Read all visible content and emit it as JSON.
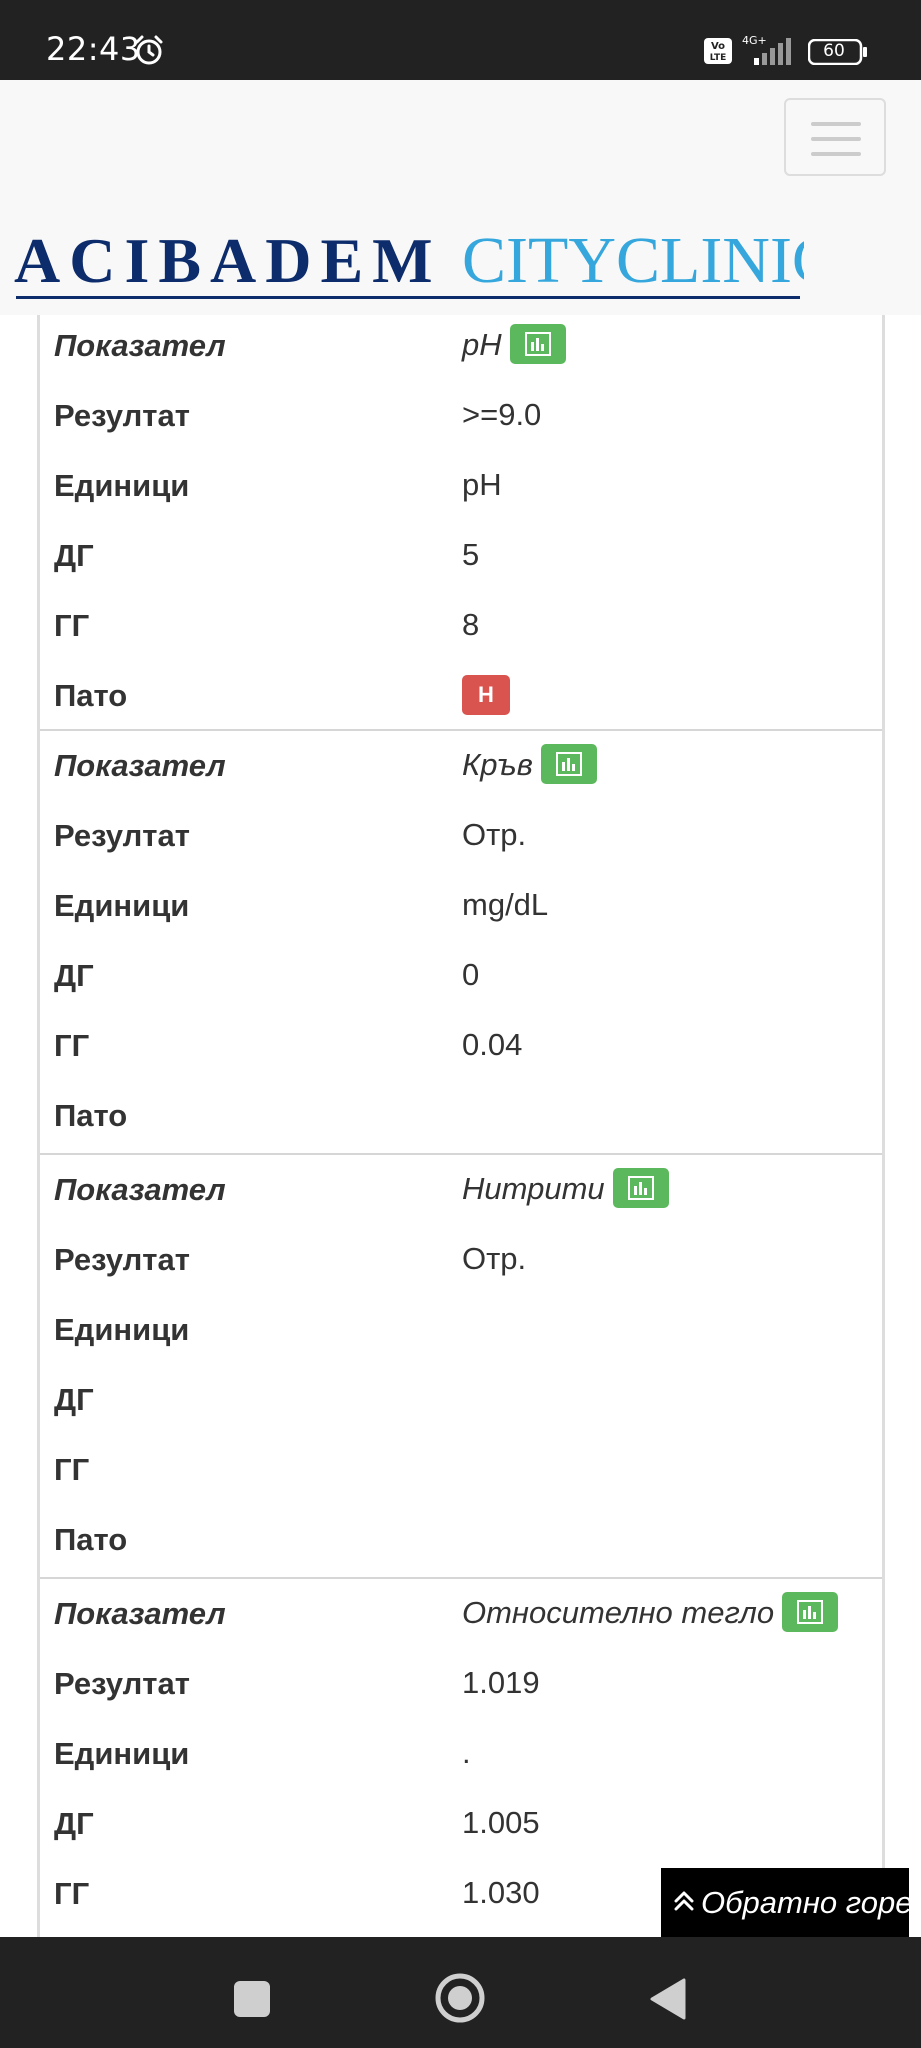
{
  "status_bar": {
    "time": "22:43",
    "battery": "60",
    "icons": [
      "alarm-icon",
      "volte-icon",
      "signal-4g-icon",
      "battery-icon"
    ]
  },
  "header": {
    "logo_primary": "ACIBADEM",
    "logo_secondary": "CITYCLINIC",
    "menu_icon": "hamburger-icon",
    "colors": {
      "logo_navy": "#0d2c6b",
      "logo_cyan": "#35a7dc"
    }
  },
  "labels": {
    "indicator": "Показател",
    "result": "Резултат",
    "units": "Единици",
    "dg": "ДГ",
    "gg": "ГГ",
    "pato": "Пато"
  },
  "records": [
    {
      "indicator": "pH",
      "result": ">=9.0",
      "units": "pH",
      "dg": "5",
      "gg": "8",
      "pato": "Н"
    },
    {
      "indicator": "Кръв",
      "result": "Отр.",
      "units": "mg/dL",
      "dg": "0",
      "gg": "0.04",
      "pato": ""
    },
    {
      "indicator": "Нитрити",
      "result": "Отр.",
      "units": "",
      "dg": "",
      "gg": "",
      "pato": ""
    },
    {
      "indicator": "Относително тегло",
      "result": "1.019",
      "units": ".",
      "dg": "1.005",
      "gg": "1.030"
    }
  ],
  "back_to_top": "Обратно горе",
  "colors": {
    "chart_button": "#5cb85c",
    "pato_badge": "#d9534f"
  }
}
